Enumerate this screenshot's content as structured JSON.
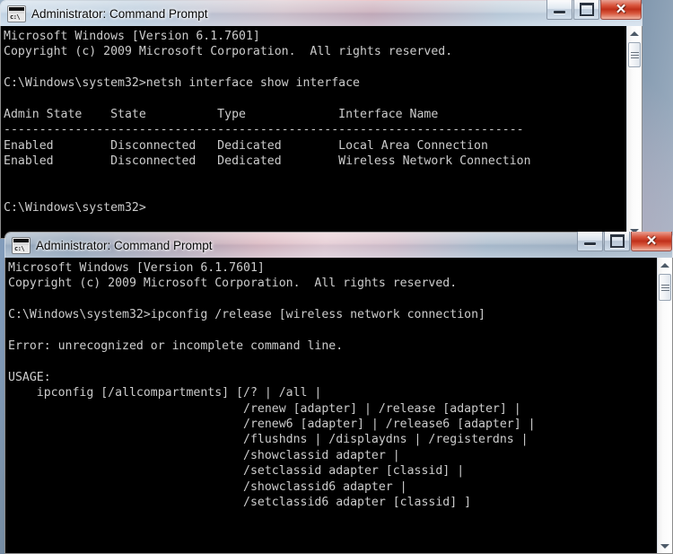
{
  "desktop": {
    "label": "windows-desktop-wallpaper"
  },
  "windows": [
    {
      "id": "window-netsh",
      "title": "Administrator: Command Prompt",
      "icon_name": "command-prompt-icon",
      "icon_glyph": "c:\\",
      "buttons": {
        "minimize": "Minimize",
        "maximize": "Maximize",
        "close": "Close"
      },
      "console_text": "Microsoft Windows [Version 6.1.7601]\nCopyright (c) 2009 Microsoft Corporation.  All rights reserved.\n\nC:\\Windows\\system32>netsh interface show interface\n\nAdmin State    State          Type             Interface Name\n-------------------------------------------------------------------------\nEnabled        Disconnected   Dedicated        Local Area Connection\nEnabled        Disconnected   Dedicated        Wireless Network Connection\n\n\nC:\\Windows\\system32>",
      "scrollbar": {
        "up_arrow": "scroll-up",
        "down_arrow": "scroll-down",
        "thumb": "scroll-thumb"
      }
    },
    {
      "id": "window-ipconfig",
      "title": "Administrator: Command Prompt",
      "icon_name": "command-prompt-icon",
      "icon_glyph": "c:\\",
      "buttons": {
        "minimize": "Minimize",
        "maximize": "Maximize",
        "close": "Close"
      },
      "console_text": "Microsoft Windows [Version 6.1.7601]\nCopyright (c) 2009 Microsoft Corporation.  All rights reserved.\n\nC:\\Windows\\system32>ipconfig /release [wireless network connection]\n\nError: unrecognized or incomplete command line.\n\nUSAGE:\n    ipconfig [/allcompartments] [/? | /all |\n                                 /renew [adapter] | /release [adapter] |\n                                 /renew6 [adapter] | /release6 [adapter] |\n                                 /flushdns | /displaydns | /registerdns |\n                                 /showclassid adapter |\n                                 /setclassid adapter [classid] |\n                                 /showclassid6 adapter |\n                                 /setclassid6 adapter [classid] ]",
      "scrollbar": {
        "up_arrow": "scroll-up",
        "down_arrow": "scroll-down",
        "thumb": "scroll-thumb"
      }
    }
  ],
  "colors": {
    "console_background": "#000000",
    "console_text": "#cccccc",
    "close_button": "#c0301a",
    "titlebar_text": "#0a0a0a"
  }
}
